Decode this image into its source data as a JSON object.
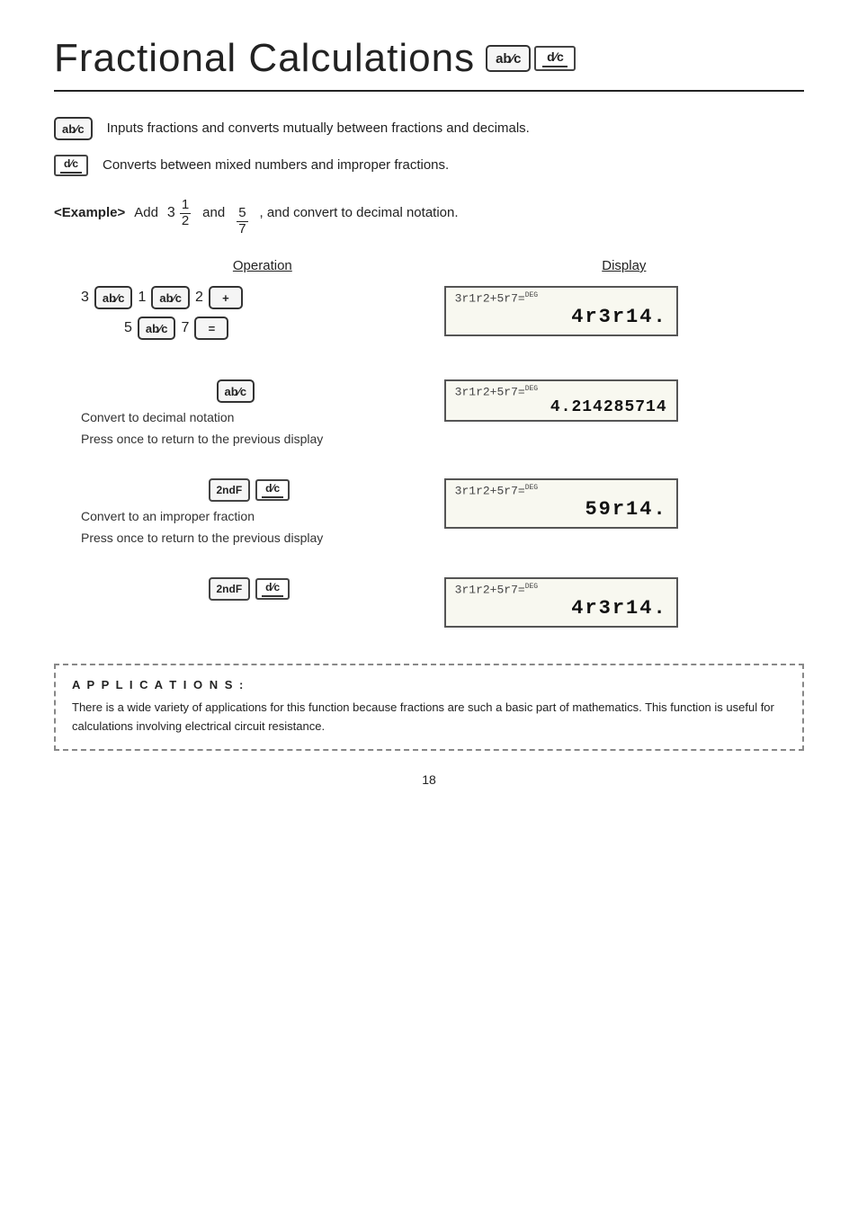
{
  "page": {
    "title": "Fractional Calculations",
    "page_number": "18"
  },
  "desc1": {
    "text": "Inputs fractions and converts mutually between fractions and decimals."
  },
  "desc2": {
    "text": "Converts between mixed numbers and improper fractions."
  },
  "example": {
    "label": "<Example>",
    "intro": "Add",
    "mixed_int": "3",
    "frac1_num": "1",
    "frac1_den": "2",
    "and": "and",
    "frac2_num": "5",
    "frac2_den": "7",
    "suffix": ", and convert to decimal notation."
  },
  "op_header": "Operation",
  "disp_header": "Display",
  "step1": {
    "display_top": "3⌐1⌐2+5⌐7=",
    "display_bottom": "4⌐3⌐14.",
    "deg": "DEG"
  },
  "step2": {
    "display_top": "3⌐1⌐2+5⌐7=",
    "display_bottom": "4.214285714",
    "deg": "DEG",
    "note1": "Convert to decimal notation",
    "note2": "Press once to return to the previous display"
  },
  "step3": {
    "display_top": "3⌐1⌐2+5⌐7=",
    "display_bottom": "59⌐14.",
    "deg": "DEG",
    "note1": "Convert to an improper fraction",
    "note2": "Press once to return to the previous display"
  },
  "step4": {
    "display_top": "3⌐1⌐2+5⌐7=",
    "display_bottom": "4⌐3⌐14.",
    "deg": "DEG"
  },
  "applications": {
    "title": "A P P L I C A T I O N S :",
    "text": "There is a wide variety of applications for this function because fractions are such a basic part of mathematics. This function is useful for calculations involving electrical circuit resistance."
  }
}
